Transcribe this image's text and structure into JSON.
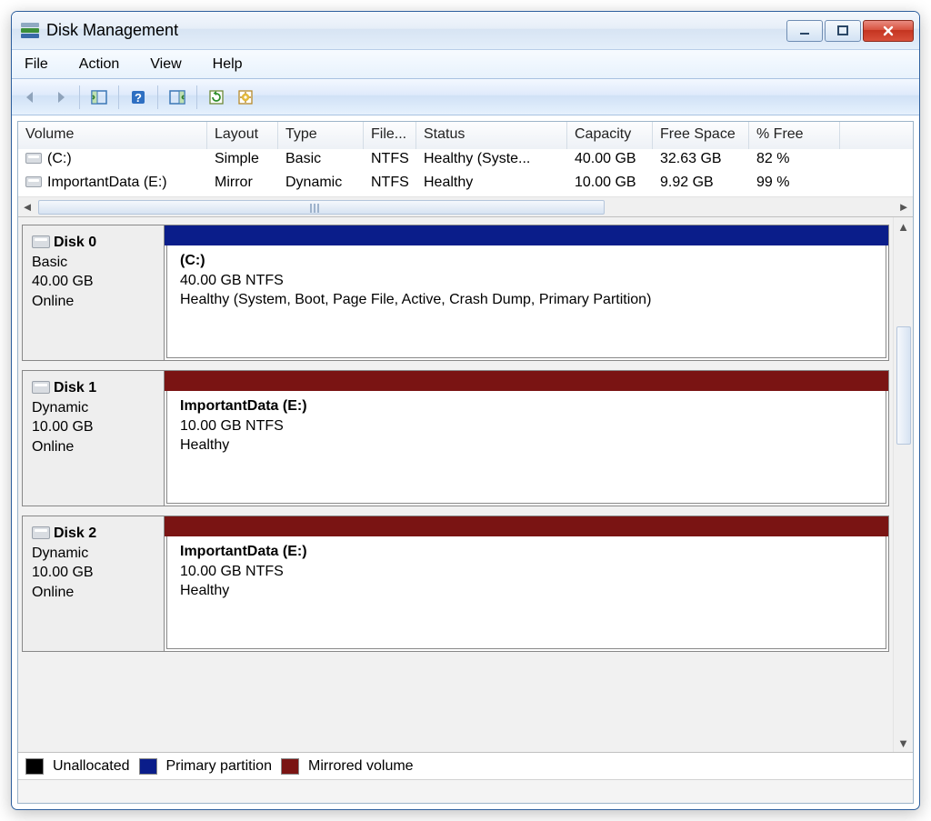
{
  "window": {
    "title": "Disk Management"
  },
  "menu": {
    "file": "File",
    "action": "Action",
    "view": "View",
    "help": "Help"
  },
  "columns": {
    "volume": "Volume",
    "layout": "Layout",
    "type": "Type",
    "fs": "File...",
    "status": "Status",
    "capacity": "Capacity",
    "free": "Free Space",
    "pct": "% Free"
  },
  "volumes": [
    {
      "name": "(C:)",
      "layout": "Simple",
      "type": "Basic",
      "fs": "NTFS",
      "status": "Healthy (Syste...",
      "capacity": "40.00 GB",
      "free": "32.63 GB",
      "pct": "82 %"
    },
    {
      "name": "ImportantData (E:)",
      "layout": "Mirror",
      "type": "Dynamic",
      "fs": "NTFS",
      "status": "Healthy",
      "capacity": "10.00 GB",
      "free": "9.92 GB",
      "pct": "99 %"
    }
  ],
  "disks": [
    {
      "name": "Disk 0",
      "type": "Basic",
      "size": "40.00 GB",
      "state": "Online",
      "stripe": "primary",
      "vol_title": "(C:)",
      "vol_line1": "40.00 GB NTFS",
      "vol_line2": "Healthy (System, Boot, Page File, Active, Crash Dump, Primary Partition)"
    },
    {
      "name": "Disk 1",
      "type": "Dynamic",
      "size": "10.00 GB",
      "state": "Online",
      "stripe": "mirror",
      "vol_title": "ImportantData  (E:)",
      "vol_line1": "10.00 GB NTFS",
      "vol_line2": "Healthy"
    },
    {
      "name": "Disk 2",
      "type": "Dynamic",
      "size": "10.00 GB",
      "state": "Online",
      "stripe": "mirror",
      "vol_title": "ImportantData  (E:)",
      "vol_line1": "10.00 GB NTFS",
      "vol_line2": "Healthy"
    }
  ],
  "legend": {
    "unallocated": "Unallocated",
    "primary": "Primary partition",
    "mirror": "Mirrored volume"
  }
}
